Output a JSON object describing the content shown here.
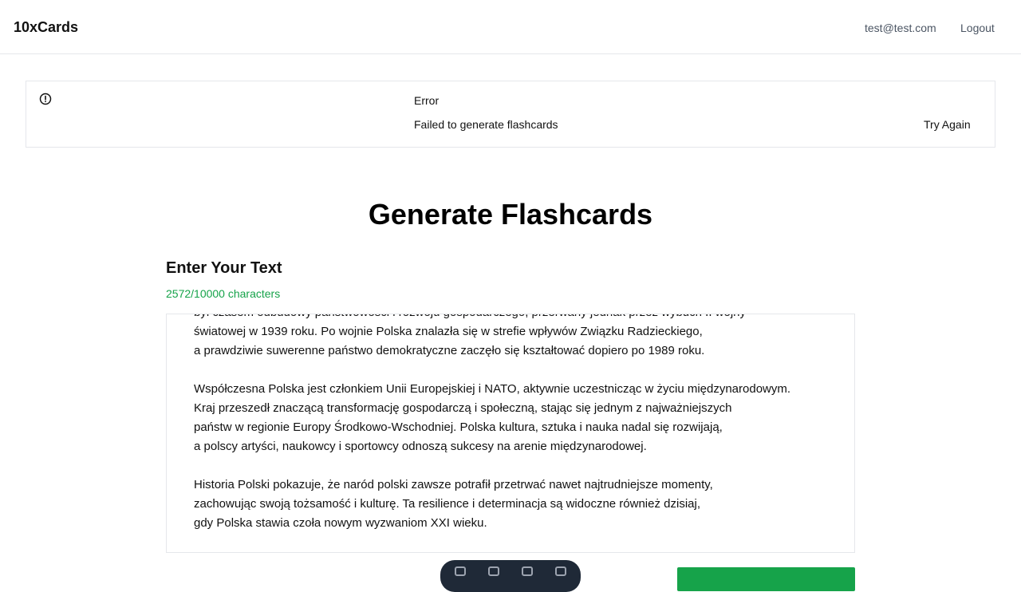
{
  "header": {
    "brand": "10xCards",
    "user_email": "test@test.com",
    "logout_label": "Logout"
  },
  "alert": {
    "icon": "alert-circle-icon",
    "title": "Error",
    "message": "Failed to generate flashcards",
    "retry_label": "Try Again"
  },
  "main": {
    "title": "Generate Flashcards",
    "section_title": "Enter Your Text",
    "char_count": "2572/10000 characters",
    "textarea_value": "był czasem odbudowy państwowości i rozwoju gospodarczego, przerwany jednak przez wybuch II wojny\nświatowej w 1939 roku. Po wojnie Polska znalazła się w strefie wpływów Związku Radzieckiego,\na prawdziwie suwerenne państwo demokratyczne zaczęło się kształtować dopiero po 1989 roku.\n\nWspółczesna Polska jest członkiem Unii Europejskiej i NATO, aktywnie uczestnicząc w życiu międzynarodowym.\nKraj przeszedł znaczącą transformację gospodarczą i społeczną, stając się jednym z najważniejszych\npaństw w regionie Europy Środkowo-Wschodniej. Polska kultura, sztuka i nauka nadal się rozwijają,\na polscy artyści, naukowcy i sportowcy odnoszą sukcesy na arenie międzynarodowej.\n\nHistoria Polski pokazuje, że naród polski zawsze potrafił przetrwać nawet najtrudniejsze momenty,\nzachowując swoją tożsamość i kulturę. Ta resilience i determinacja są widoczne również dzisiaj,\ngdy Polska stawia czoła nowym wyzwaniom XXI wieku."
  },
  "colors": {
    "accent_green": "#16a34a",
    "toolbar_dark": "#1f2937"
  }
}
